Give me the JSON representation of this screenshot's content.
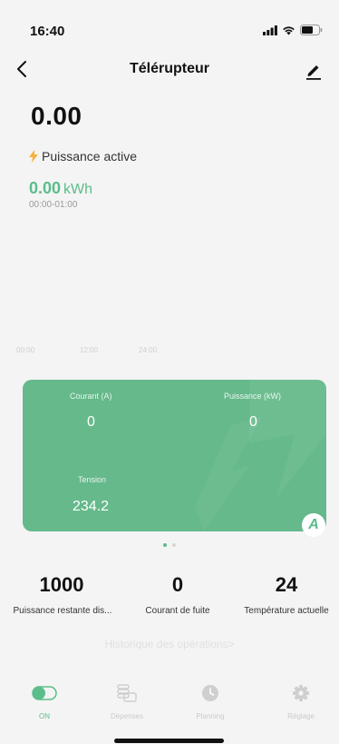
{
  "status_bar": {
    "time": "16:40"
  },
  "nav": {
    "title": "Télérupteur"
  },
  "main": {
    "value": "0.00",
    "power_label": "Puissance active",
    "energy_value": "0.00",
    "energy_unit": "kWh",
    "energy_range": "00:00-01:00"
  },
  "chart_axis": {
    "ticks": [
      "00:00",
      "12:00",
      "24:00"
    ]
  },
  "card": {
    "current_label": "Courant (A)",
    "current_value": "0",
    "power_label": "Puissance (kW)",
    "power_value": "0",
    "voltage_label": "Tension",
    "voltage_value": "234.2",
    "badge": "A"
  },
  "pager": {
    "count": 2,
    "active": 0
  },
  "stats": [
    {
      "value": "1000",
      "label": "Puissance restante dis..."
    },
    {
      "value": "0",
      "label": "Courant de fuite"
    },
    {
      "value": "24",
      "label": "Température actuelle"
    }
  ],
  "history_link": "Historique des opérations>",
  "tabs": [
    {
      "label": "ON",
      "icon": "toggle-icon",
      "active": true
    },
    {
      "label": "Dépenses",
      "icon": "coins-icon",
      "active": false
    },
    {
      "label": "Planning",
      "icon": "clock-icon",
      "active": false
    },
    {
      "label": "Réglage",
      "icon": "gear-icon",
      "active": false
    }
  ],
  "colors": {
    "accent": "#5bbd8a",
    "card": "#65b98b",
    "background": "#f4f4f4"
  }
}
